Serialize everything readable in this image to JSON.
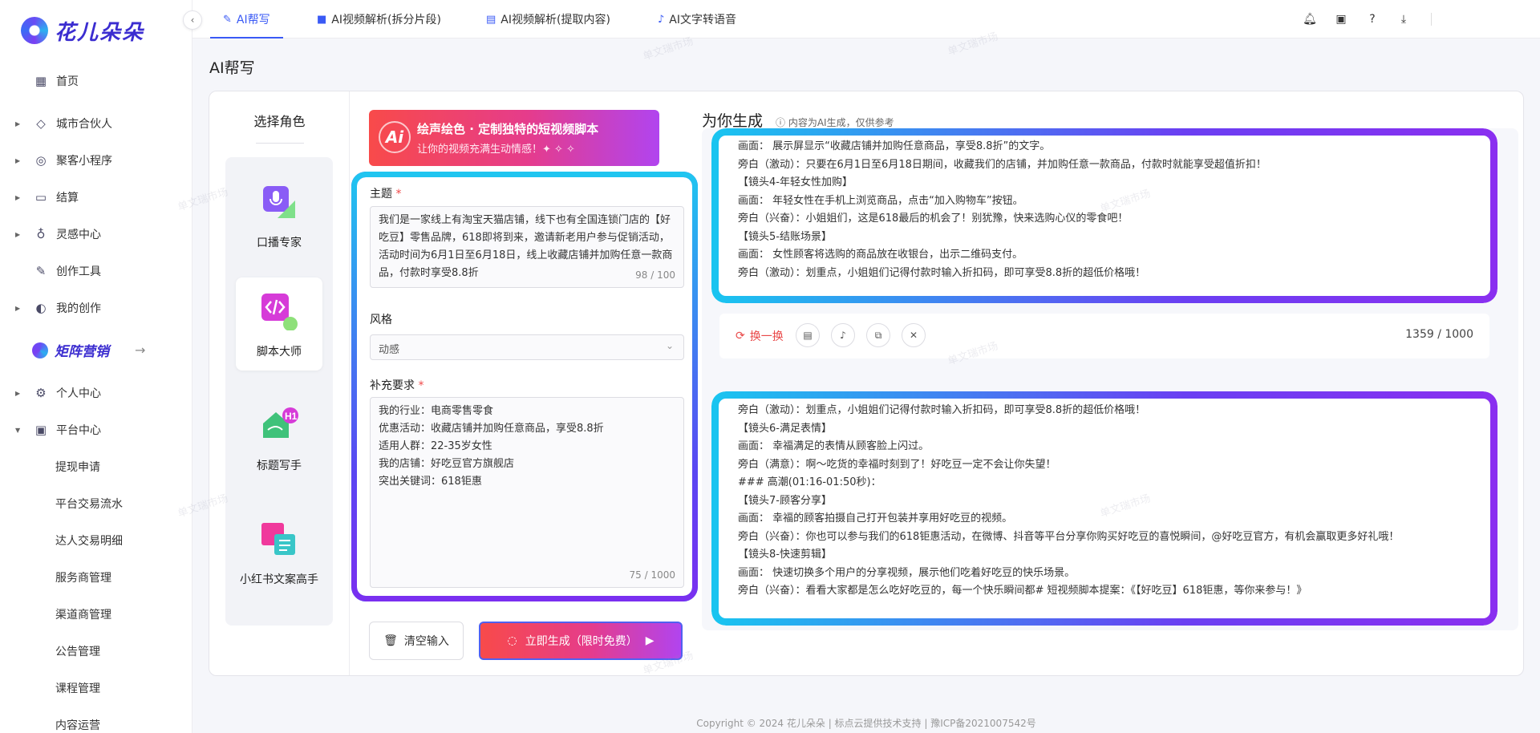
{
  "app": {
    "name": "花儿朵朵"
  },
  "sidebar": {
    "items": [
      {
        "label": "首页",
        "icon": "grid-icon"
      },
      {
        "label": "城市合伙人",
        "icon": "diamond-icon"
      },
      {
        "label": "聚客小程序",
        "icon": "compass-icon"
      },
      {
        "label": "结算",
        "icon": "wallet-icon"
      },
      {
        "label": "灵感中心",
        "icon": "bulb-icon"
      },
      {
        "label": "创作工具",
        "icon": "pen-icon"
      },
      {
        "label": "我的创作",
        "icon": "planet-icon"
      },
      {
        "label": "个人中心",
        "icon": "gear-icon"
      },
      {
        "label": "平台中心",
        "icon": "chart-icon"
      }
    ],
    "matrix_label": "矩阵营销",
    "sub_items": [
      "提现申请",
      "平台交易流水",
      "达人交易明细",
      "服务商管理",
      "渠道商管理",
      "公告管理",
      "课程管理",
      "内容运营"
    ]
  },
  "tabs": [
    "AI帮写",
    "AI视频解析(拆分片段)",
    "AI视频解析(提取内容)",
    "AI文字转语音"
  ],
  "page_title": "AI帮写",
  "roles": {
    "title": "选择角色",
    "items": [
      "口播专家",
      "脚本大师",
      "标题写手",
      "小红书文案高手"
    ]
  },
  "banner": {
    "badge": "Ai",
    "title": "绘声绘色 · 定制独特的短视频脚本",
    "subtitle": "让你的视频充满生动情感！✦ ✧ ✧"
  },
  "form": {
    "topic_label": "主题",
    "required_mark": "*",
    "topic_value": "我们是一家线上有淘宝天猫店铺，线下也有全国连锁门店的【好吃豆】零售品牌，618即将到来，邀请新老用户参与促销活动，活动时间为6月1日至6月18日，线上收藏店铺并加购任意一款商品，付款时享受8.8折",
    "topic_count": "98 / 100",
    "style_label": "风格",
    "style_value": "动感",
    "extra_label": "补充要求",
    "extra_lines": [
      "我的行业：电商零售零食",
      "优惠活动：收藏店铺并加购任意商品，享受8.8折",
      "适用人群：22-35岁女性",
      "我的店铺：好吃豆官方旗舰店",
      "突出关键词：618钜惠"
    ],
    "extra_count": "75 / 1000",
    "clear_label": "清空输入",
    "generate_label": "立即生成（限时免费）"
  },
  "result": {
    "title": "为你生成",
    "note": "内容为AI生成，仅供参考",
    "box1": [
      "画面：  展示屏显示“收藏店铺并加购任意商品，享受8.8折”的文字。",
      "旁白（激动）：只要在6月1日至6月18日期间，收藏我们的店铺，并加购任意一款商品，付款时就能享受超值折扣！",
      "【镜头4-年轻女性加购】",
      "画面：  年轻女性在手机上浏览商品，点击“加入购物车”按钮。",
      "旁白（兴奋）：小姐姐们，这是618最后的机会了！别犹豫，快来选购心仪的零食吧！",
      "【镜头5-结账场景】",
      "画面：  女性顾客将选购的商品放在收银台，出示二维码支付。",
      "旁白（激动）：划重点，小姐姐们记得付款时输入折扣码，即可享受8.8折的超低价格哦！"
    ],
    "swap_label": "换一换",
    "word_count": "1359 / 1000",
    "box2": [
      "旁白（激动）：划重点，小姐姐们记得付款时输入折扣码，即可享受8.8折的超低价格哦！",
      "【镜头6-满足表情】",
      "画面：  幸福满足的表情从顾客脸上闪过。",
      "旁白（满意）：啊～吃货的幸福时刻到了！好吃豆一定不会让你失望！",
      "### 高潮(01:16-01:50秒)：",
      "【镜头7-顾客分享】",
      "画面：  幸福的顾客拍摄自己打开包装并享用好吃豆的视频。",
      "旁白（兴奋）：你也可以参与我们的618钜惠活动，在微博、抖音等平台分享你购买好吃豆的喜悦瞬间，@好吃豆官方，有机会赢取更多好礼哦！",
      "【镜头8-快速剪辑】",
      "画面：  快速切换多个用户的分享视频，展示他们吃着好吃豆的快乐场景。",
      "旁白（兴奋）：看看大家都是怎么吃好吃豆的，每一个快乐瞬间都# 短视频脚本提案：《【好吃豆】618钜惠，等你来参与！》"
    ]
  },
  "footer": "Copyright © 2024 花儿朵朵 | 标点云提供技术支持 | 豫ICP备2021007542号",
  "watermark": "单文瑞市场"
}
